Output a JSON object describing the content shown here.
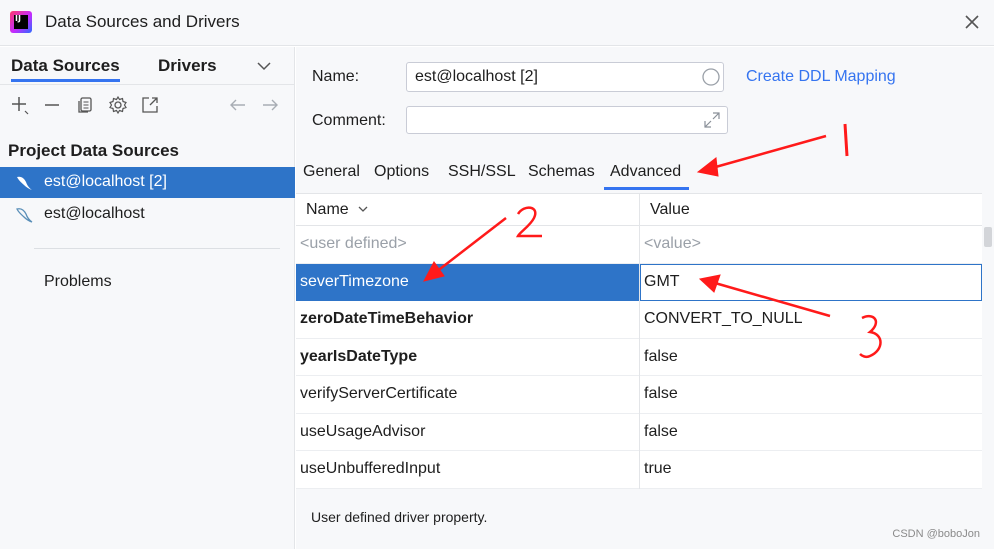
{
  "window": {
    "title": "Data Sources and Drivers"
  },
  "left_tabs": [
    {
      "label": "Data Sources",
      "active": true
    },
    {
      "label": "Drivers",
      "active": false
    }
  ],
  "toolbar": {
    "icons": [
      "add-icon",
      "remove-icon",
      "duplicate-icon",
      "settings-icon",
      "open-icon",
      "back-icon",
      "forward-icon"
    ]
  },
  "left": {
    "section_title": "Project Data Sources",
    "items": [
      {
        "label": "est@localhost [2]",
        "selected": true,
        "icon": "mysql-icon"
      },
      {
        "label": "est@localhost",
        "selected": false,
        "icon": "mysql-icon"
      }
    ],
    "problems_label": "Problems"
  },
  "form": {
    "name_label": "Name:",
    "name_value": "est@localhost [2]",
    "comment_label": "Comment:",
    "comment_value": "",
    "ddl_link": "Create DDL Mapping"
  },
  "tabs": [
    {
      "label": "General",
      "active": false
    },
    {
      "label": "Options",
      "active": false
    },
    {
      "label": "SSH/SSL",
      "active": false
    },
    {
      "label": "Schemas",
      "active": false
    },
    {
      "label": "Advanced",
      "active": true
    }
  ],
  "grid": {
    "headers": {
      "name": "Name",
      "value": "Value"
    },
    "rows": [
      {
        "name": "<user defined>",
        "value": "<value>",
        "placeholder": true
      },
      {
        "name": "severTimezone",
        "value": "GMT",
        "selected": true
      },
      {
        "name": "zeroDateTimeBehavior",
        "value": "CONVERT_TO_NULL",
        "bold": true
      },
      {
        "name": "yearIsDateType",
        "value": "false",
        "bold": true
      },
      {
        "name": "verifyServerCertificate",
        "value": "false"
      },
      {
        "name": "useUsageAdvisor",
        "value": "false"
      },
      {
        "name": "useUnbufferedInput",
        "value": "true"
      }
    ]
  },
  "description": "User defined driver property.",
  "watermark": "CSDN @boboJon",
  "colors": {
    "accent": "#3574f0",
    "selection": "#2e74c8",
    "annotation": "#ff1a1a"
  }
}
